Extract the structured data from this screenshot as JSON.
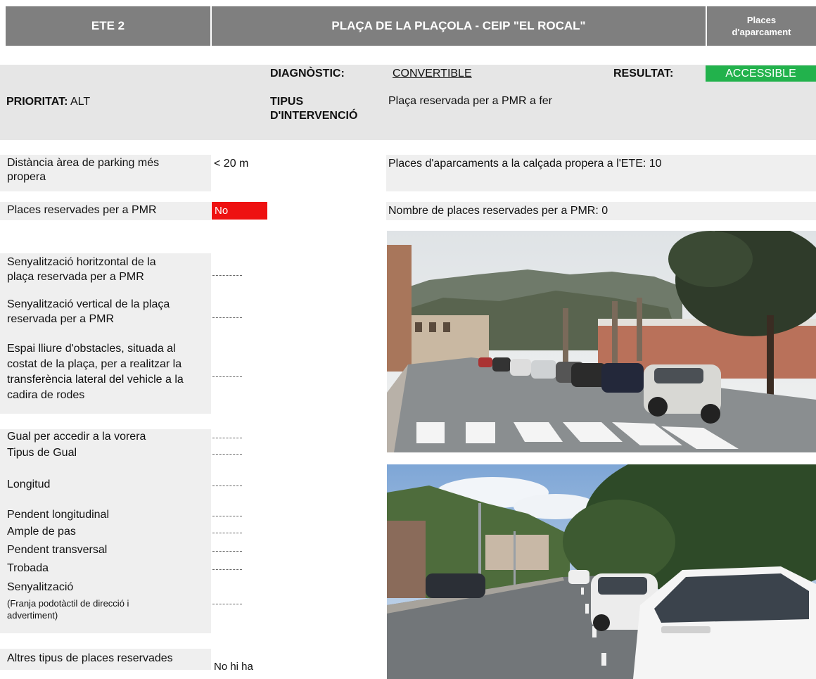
{
  "header": {
    "code": "ETE 2",
    "title": "PLAÇA DE LA PLAÇOLA - CEIP \"EL ROCAL\"",
    "category_line1": "Places",
    "category_line2": "d'aparcament"
  },
  "diagnosis": {
    "diag_label": "DIAGNÒSTIC:",
    "diag_value": "CONVERTIBLE",
    "result_label": "RESULTAT:",
    "result_value": "ACCESSIBLE",
    "result_color": "#22b24c",
    "priority_label": "PRIORITAT:",
    "priority_value": "ALT",
    "intervention_label_1": "TIPUS",
    "intervention_label_2": "D'INTERVENCIÓ",
    "intervention_value": "Plaça reservada per a PMR a fer"
  },
  "fields": {
    "distance_line1": "Distància àrea de parking més",
    "distance_line2": "propera",
    "distance_value": "< 20 m",
    "street_places": "Places d'aparcaments a la calçada propera a l'ETE: 10",
    "reserved_label": "Places reservades per a PMR",
    "reserved_value": "No",
    "reserved_color": "#ee1111",
    "reserved_count": "Nombre de places reservades per a PMR: 0",
    "horiz_line1": "Senyalització horitzontal de la",
    "horiz_line2": "plaça reservada per a PMR",
    "vert_line1": "Senyalització vertical de la plaça",
    "vert_line2": "reservada per a PMR",
    "space_line1": "Espai lliure d'obstacles, situada al",
    "space_line2": "costat de la plaça, per a realitzar la",
    "space_line3": "transferència lateral del vehicle a la",
    "space_line4": "cadira de rodes",
    "gual": "Gual per accedir a la vorera",
    "gual_type": "Tipus de Gual",
    "length": "Longitud",
    "long_slope": "Pendent longitudinal",
    "pass_width": "Ample de pas",
    "cross_slope": "Pendent transversal",
    "meeting": "Trobada",
    "signage": "Senyalització",
    "signage_sub_1": "(Franja podotàctil de direcció i",
    "signage_sub_2": "advertiment)",
    "other_label": "Altres tipus de places reservades",
    "other_value": "No hi ha"
  },
  "photos": [
    {
      "name": "street-photo-crosswalk"
    },
    {
      "name": "street-photo-parked-cars"
    }
  ]
}
